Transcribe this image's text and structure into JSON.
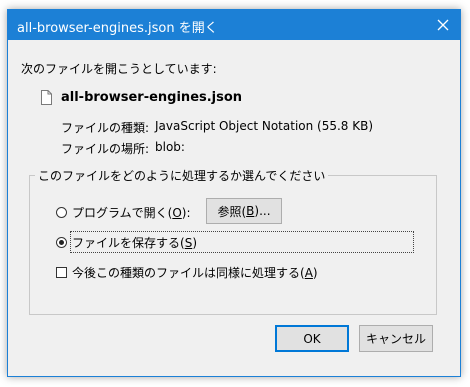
{
  "window": {
    "title": "all-browser-engines.json を開く"
  },
  "intro": "次のファイルを開こうとしています:",
  "file": {
    "icon": "file-icon",
    "name": "all-browser-engines.json",
    "type_label": "ファイルの種類:",
    "type_value": "JavaScript Object Notation (55.8 KB)",
    "location_label": "ファイルの場所:",
    "location_value": "blob:"
  },
  "group": {
    "legend": "このファイルをどのように処理するか選んでください"
  },
  "options": {
    "open_with": {
      "label": "プログラムで開く(",
      "accel": "O",
      "suffix": "):",
      "selected": false
    },
    "browse_button": {
      "label": "参照(",
      "accel": "B",
      "suffix": ")..."
    },
    "save_file": {
      "label": "ファイルを保存する(",
      "accel": "S",
      "suffix": ")",
      "selected": true
    },
    "remember": {
      "label": "今後この種類のファイルは同様に処理する(",
      "accel": "A",
      "suffix": ")",
      "checked": false
    }
  },
  "buttons": {
    "ok": "OK",
    "cancel": "キャンセル"
  },
  "colors": {
    "title_bar": "#1c80d6",
    "dialog_bg": "#f0f0f0",
    "default_button_border": "#0078d7"
  }
}
